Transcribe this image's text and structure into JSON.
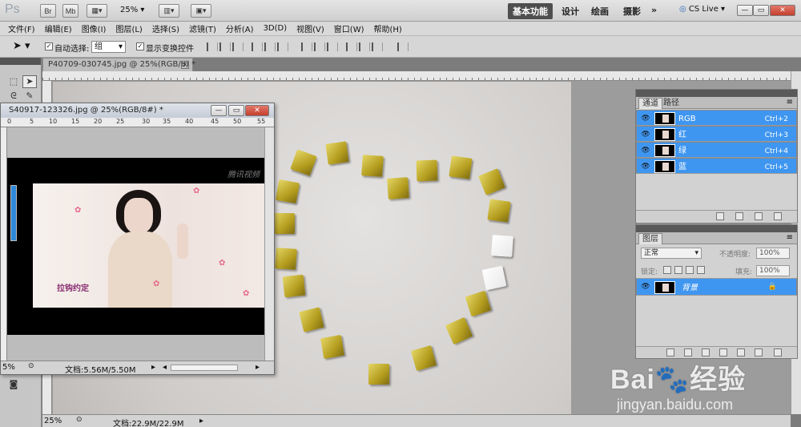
{
  "app": {
    "logo": "Ps",
    "bar_buttons": [
      "Br",
      "Mb"
    ],
    "zoom": "25%",
    "workspaces": [
      "基本功能",
      "设计",
      "绘画",
      "摄影"
    ],
    "more": "»",
    "cs_live": "CS Live"
  },
  "menu": [
    "文件(F)",
    "编辑(E)",
    "图像(I)",
    "图层(L)",
    "选择(S)",
    "滤镜(T)",
    "分析(A)",
    "3D(D)",
    "视图(V)",
    "窗口(W)",
    "帮助(H)"
  ],
  "options": {
    "auto_select_label": "自动选择:",
    "auto_select_value": "组",
    "show_transform_label": "显示变换控件"
  },
  "main_doc": {
    "tab_title": "P40709-030745.jpg @ 25%(RGB/8) *",
    "zoom": "25%",
    "doc_size": "文档:22.9M/22.9M"
  },
  "float_doc": {
    "title": "S40917-123326.jpg @ 25%(RGB/8#) *",
    "ruler_ticks": [
      "0",
      "5",
      "10",
      "15",
      "20",
      "25",
      "30",
      "35",
      "40",
      "45",
      "50",
      "55"
    ],
    "zoom": "5%",
    "doc_size": "文档:5.56M/5.50M",
    "video_text": "拉钩约定",
    "video_logo": "腾讯视频"
  },
  "channels_panel": {
    "tabs": [
      "通道",
      "路径"
    ],
    "rows": [
      {
        "name": "RGB",
        "shortcut": "Ctrl+2"
      },
      {
        "name": "红",
        "shortcut": "Ctrl+3"
      },
      {
        "name": "绿",
        "shortcut": "Ctrl+4"
      },
      {
        "name": "蓝",
        "shortcut": "Ctrl+5"
      }
    ]
  },
  "layers_panel": {
    "tab": "图层",
    "blend_mode": "正常",
    "opacity_label": "不透明度:",
    "opacity": "100%",
    "lock_label": "锁定:",
    "fill_label": "填充:",
    "fill": "100%",
    "layer_name": "背景"
  },
  "watermark": {
    "brand": "Bai",
    "brand2": "经验",
    "url": "jingyan.baidu.com"
  }
}
